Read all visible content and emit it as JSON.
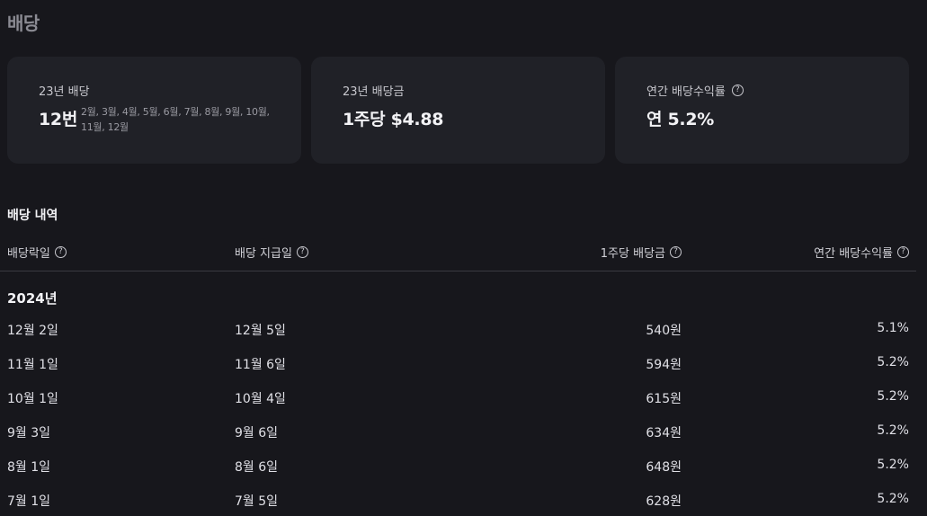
{
  "page": {
    "title": "배당"
  },
  "cards": [
    {
      "label": "23년 배당",
      "value": "12번",
      "months": "2월, 3월, 4월, 5월, 6월, 7월, 8월, 9월, 10월, 11월, 12월",
      "has_help": false
    },
    {
      "label": "23년 배당금",
      "value": "1주당 $4.88",
      "has_help": false
    },
    {
      "label": "연간 배당수익률",
      "value": "연 5.2%",
      "has_help": true
    }
  ],
  "history": {
    "title": "배당 내역",
    "columns": [
      "배당락일",
      "배당 지급일",
      "1주당 배당금",
      "연간 배당수익률"
    ],
    "year": "2024년",
    "rows": [
      [
        "12월 2일",
        "12월 5일",
        "540원",
        "5.1%"
      ],
      [
        "11월 1일",
        "11월 6일",
        "594원",
        "5.2%"
      ],
      [
        "10월 1일",
        "10월 4일",
        "615원",
        "5.2%"
      ],
      [
        "9월 3일",
        "9월 6일",
        "634원",
        "5.2%"
      ],
      [
        "8월 1일",
        "8월 6일",
        "648원",
        "5.2%"
      ],
      [
        "7월 1일",
        "7월 5일",
        "628원",
        "5.2%"
      ]
    ]
  },
  "icons": {
    "help": "question-circle-icon"
  },
  "colors": {
    "background": "#17171c",
    "card": "#202127",
    "divider": "#3a3a42"
  }
}
